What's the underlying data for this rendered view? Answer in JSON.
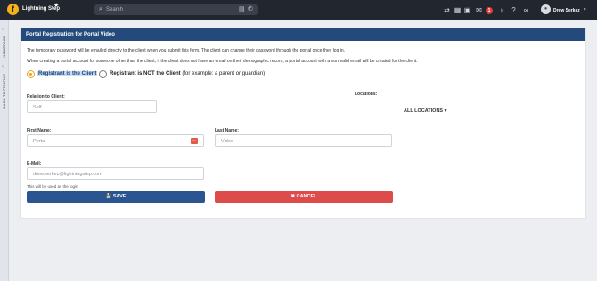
{
  "app": {
    "brand": "Lightning Step",
    "logo_letter": "f",
    "accent": "#f5b01a"
  },
  "topbar": {
    "search_placeholder": "Search",
    "notification_count": "1",
    "user_name": "Drew Serkez",
    "icons": [
      "star-icon",
      "search-icon",
      "id-card-icon",
      "phone-icon",
      "swap-icon",
      "calendar-icon",
      "grid-icon",
      "chat-icon",
      "bell-icon",
      "help-icon",
      "link-icon",
      "avatar",
      "caret-down-icon"
    ]
  },
  "sidenav": {
    "homepage": "HOMEPAGE",
    "back_to_profile": "BACK TO PROFILE"
  },
  "form": {
    "title": "Portal Registration for Portal Video",
    "note1": "The temporary password will be emailed directly to the client when you submit this form. The client can change their password through the portal once they log in.",
    "note2": "When creating a portal account for someone other than the client, if the client does not have an email on their demographic record, a portal account with a non-valid email will be created for the client.",
    "radio_client": "Registrant is the Client",
    "radio_not_client": "Registrant is NOT the Client",
    "radio_not_client_hint": "(for example: a parent or guardian)",
    "relation_label": "Relation to Client:",
    "relation_value": "Self",
    "locations_label": "Locations:",
    "locations_value": "ALL LOCATIONS ▾",
    "first_name_label": "First Name:",
    "first_name_value": "Portal",
    "last_name_label": "Last Name:",
    "last_name_value": "Video",
    "email_label": "E-Mail:",
    "email_value": "drew.serkez@lightningstep.com",
    "email_help": "This will be used as the login",
    "save_label": "💾 SAVE",
    "cancel_label": "✖ CANCEL",
    "colors": {
      "header": "#244a7c",
      "save": "#2b5591",
      "cancel": "#dd4b4b"
    }
  }
}
